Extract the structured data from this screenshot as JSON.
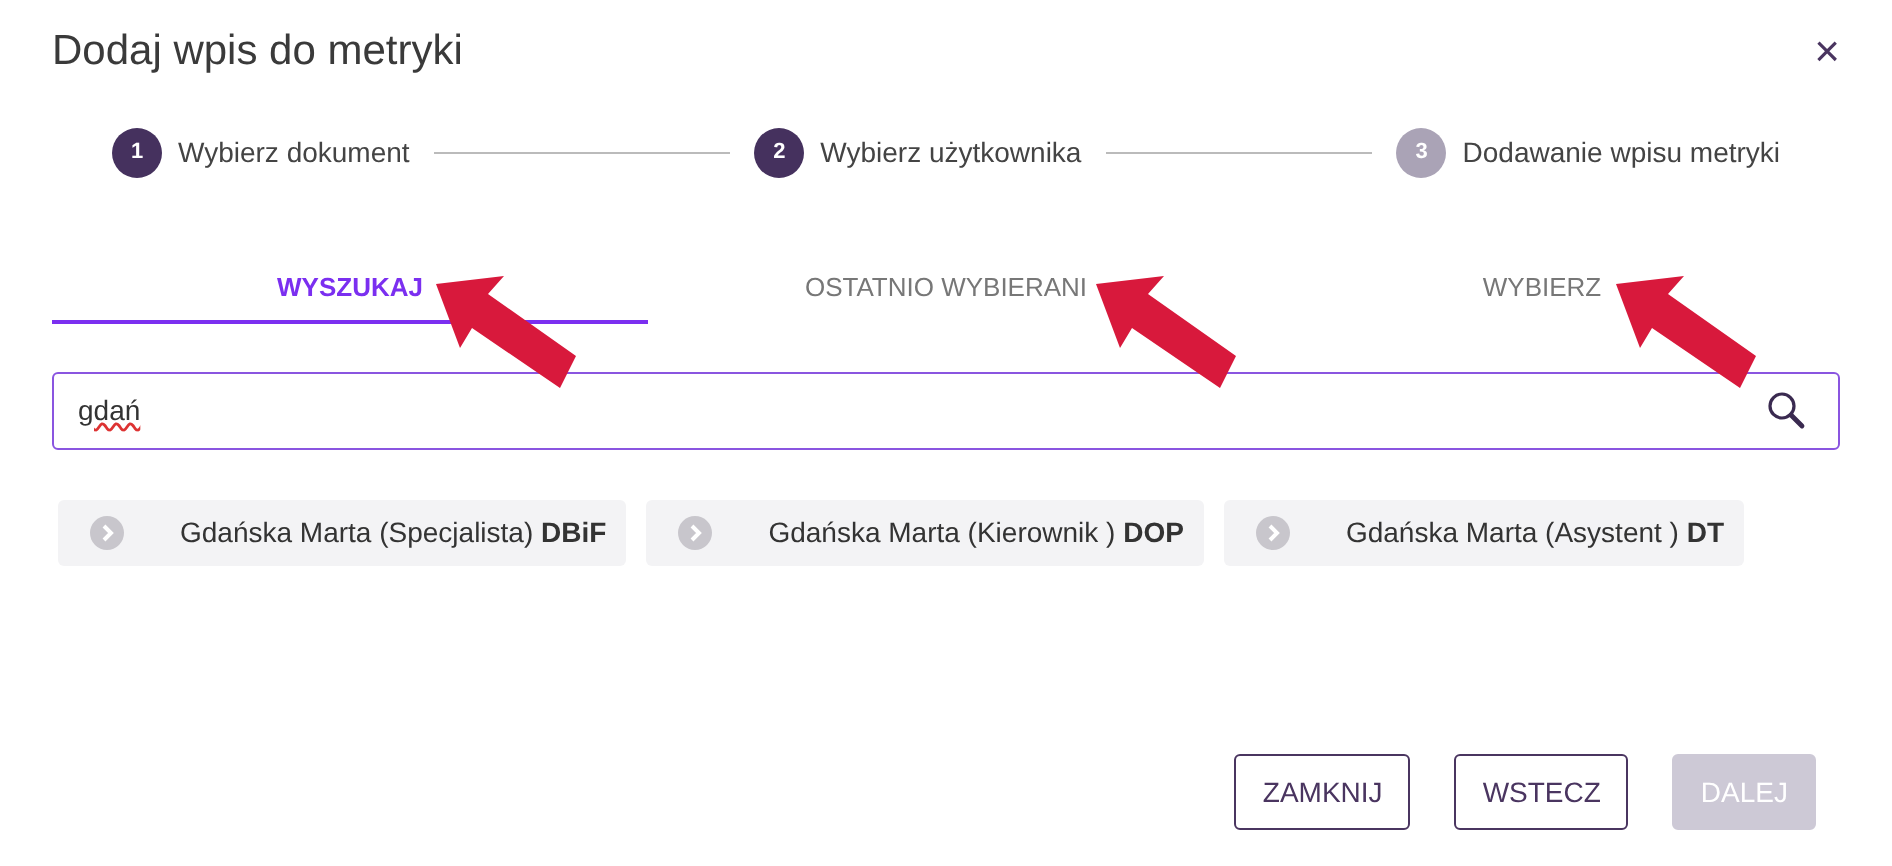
{
  "dialog": {
    "title": "Dodaj wpis do metryki",
    "close": "×"
  },
  "steps": [
    {
      "number": "1",
      "label": "Wybierz dokument",
      "active": true
    },
    {
      "number": "2",
      "label": "Wybierz użytkownika",
      "active": true
    },
    {
      "number": "3",
      "label": "Dodawanie wpisu metryki",
      "active": false
    }
  ],
  "tabs": [
    {
      "label": "WYSZUKAJ",
      "selected": true
    },
    {
      "label": "OSTATNIO WYBIERANI",
      "selected": false
    },
    {
      "label": "WYBIERZ",
      "selected": false
    }
  ],
  "search": {
    "value": "gdań"
  },
  "results": [
    {
      "text": "Gdańska Marta (Specjalista) **DBiF**"
    },
    {
      "text": "Gdańska Marta (Kierownik ) **DOP**"
    },
    {
      "text": "Gdańska Marta (Asystent ) **DT**"
    }
  ],
  "buttons": [
    {
      "label": "ZAMKNIJ",
      "disabled": false
    },
    {
      "label": "WSTECZ",
      "disabled": false
    },
    {
      "label": "DALEJ",
      "disabled": true
    }
  ]
}
